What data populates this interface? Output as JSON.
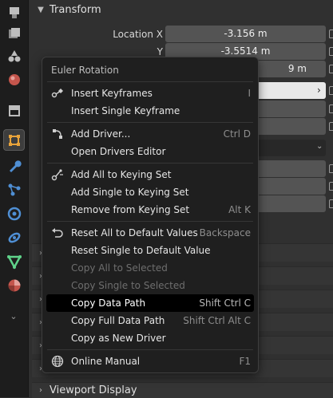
{
  "tabs": [
    {
      "name": "tool-tab-icon"
    },
    {
      "name": "render-tab-icon"
    },
    {
      "name": "output-tab-icon"
    },
    {
      "name": "view-layer-tab-icon"
    },
    {
      "name": "scene-tab-icon"
    },
    {
      "name": "world-tab-icon"
    },
    {
      "name": "collection-tab-icon"
    },
    {
      "name": "object-tab-icon"
    },
    {
      "name": "modifier-tab-icon"
    },
    {
      "name": "particles-tab-icon"
    },
    {
      "name": "physics-tab-icon"
    },
    {
      "name": "constraints-tab-icon"
    },
    {
      "name": "data-tab-icon"
    },
    {
      "name": "material-tab-icon"
    }
  ],
  "panel": {
    "transform_title": "Transform",
    "location_x_label": "Location X",
    "location_x_value": "-3.156 m",
    "location_y_label": "Y",
    "location_y_value": "-3.5514 m",
    "location_z_value": "9 m",
    "viewport_display_title": "Viewport Display"
  },
  "menu": {
    "title": "Euler Rotation",
    "items": [
      {
        "label": "Insert Keyframes",
        "shortcut": "I",
        "icon": "keyframe-icon"
      },
      {
        "label": "Insert Single Keyframe",
        "shortcut": ""
      },
      {
        "label": "Add Driver...",
        "shortcut": "Ctrl D",
        "icon": "driver-icon"
      },
      {
        "label": "Open Drivers Editor",
        "shortcut": ""
      },
      {
        "label": "Add All to Keying Set",
        "shortcut": "",
        "icon": "keying-set-icon"
      },
      {
        "label": "Add Single to Keying Set",
        "shortcut": ""
      },
      {
        "label": "Remove from Keying Set",
        "shortcut": "Alt K"
      },
      {
        "label": "Reset All to Default Values",
        "shortcut": "Backspace",
        "icon": "reset-icon"
      },
      {
        "label": "Reset Single to Default Value",
        "shortcut": ""
      },
      {
        "label": "Copy All to Selected",
        "shortcut": ""
      },
      {
        "label": "Copy Single to Selected",
        "shortcut": ""
      },
      {
        "label": "Copy Data Path",
        "shortcut": "Shift Ctrl C"
      },
      {
        "label": "Copy Full Data Path",
        "shortcut": "Shift Ctrl Alt C"
      },
      {
        "label": "Copy as New Driver",
        "shortcut": ""
      },
      {
        "label": "Online Manual",
        "shortcut": "F1",
        "icon": "globe-icon"
      }
    ]
  },
  "colors": {
    "accent_orange": "#e8a33a",
    "highlight": "#000000"
  }
}
